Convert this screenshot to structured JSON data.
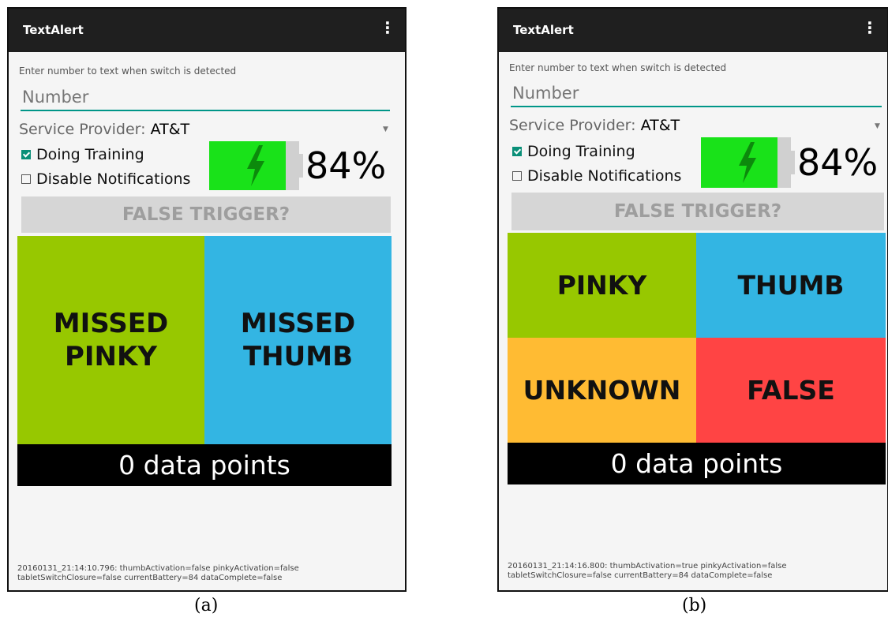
{
  "colors": {
    "pinky": "#97c800",
    "thumb": "#33b5e3",
    "unknown": "#ffbb33",
    "false": "#ff4444",
    "battery": "#19e219",
    "accent": "#009688"
  },
  "icons": [
    "overflow-menu-icon",
    "checkbox-icon",
    "battery-charging-icon",
    "lightning-bolt-icon",
    "dropdown-arrow-icon"
  ],
  "panel_a": {
    "app_title": "TextAlert",
    "menu_glyph": "⋮",
    "hint": "Enter number to text when switch is detected",
    "number_placeholder": "Number",
    "provider_label": "Service Provider:",
    "provider_value": "AT&T",
    "doing_training_label": "Doing Training",
    "doing_training_checked": true,
    "disable_notifications_label": "Disable Notifications",
    "disable_notifications_checked": false,
    "battery_percent": "84%",
    "battery_level": 0.84,
    "false_trigger_label": "FALSE TRIGGER?",
    "tile_missed_pinky": "MISSED\nPINKY",
    "tile_missed_thumb": "MISSED\nTHUMB",
    "data_points": "0 data points",
    "log_line1": "20160131_21:14:10.796: thumbActivation=false pinkyActivation=false",
    "log_line2": "tabletSwitchClosure=false currentBattery=84 dataComplete=false",
    "caption": "(a)"
  },
  "panel_b": {
    "app_title": "TextAlert",
    "menu_glyph": "⋮",
    "hint": "Enter number to text when switch is detected",
    "number_placeholder": "Number",
    "provider_label": "Service Provider:",
    "provider_value": "AT&T",
    "doing_training_label": "Doing Training",
    "doing_training_checked": true,
    "disable_notifications_label": "Disable Notifications",
    "disable_notifications_checked": false,
    "battery_percent": "84%",
    "battery_level": 0.84,
    "false_trigger_label": "FALSE TRIGGER?",
    "tile_pinky": "PINKY",
    "tile_thumb": "THUMB",
    "tile_unknown": "UNKNOWN",
    "tile_false": "FALSE",
    "data_points": "0 data points",
    "log_line1": "20160131_21:14:16.800: thumbActivation=true pinkyActivation=false",
    "log_line2": "tabletSwitchClosure=false currentBattery=84 dataComplete=false",
    "caption": "(b)"
  }
}
